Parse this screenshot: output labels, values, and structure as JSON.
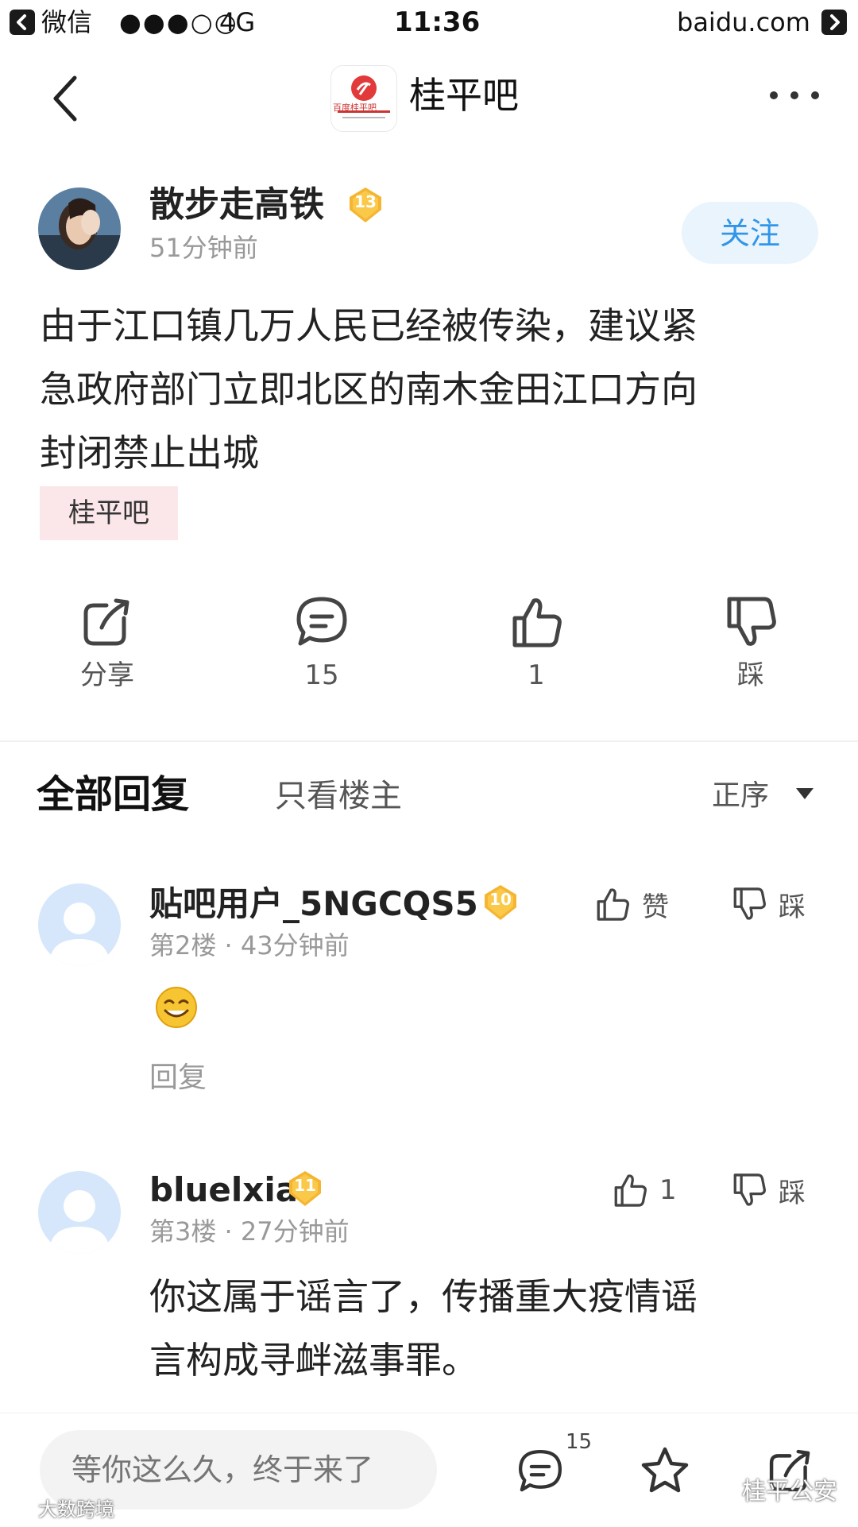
{
  "status_bar": {
    "app": "微信",
    "network": "4G",
    "time": "11:36",
    "url": "baidu.com",
    "signal_dots": "●●●○○"
  },
  "nav": {
    "title": "桂平吧",
    "logo_text": "百度桂平吧"
  },
  "post": {
    "author": "散步走高铁",
    "level": "13",
    "time": "51分钟前",
    "follow_label": "关注",
    "lines": [
      "由于江口镇几万人民已经被传染，建议紧",
      "急政府部门立即北区的南木金田江口方向",
      "封闭禁止出城"
    ],
    "tag": "桂平吧"
  },
  "actions": {
    "share": "分享",
    "comments": "15",
    "likes": "1",
    "dislike": "踩"
  },
  "tabs": {
    "all_replies": "全部回复",
    "op_only": "只看楼主",
    "sort": "正序"
  },
  "replies": [
    {
      "name": "贴吧用户_5NGCQS5",
      "level": "10",
      "meta": "第2楼 · 43分钟前",
      "like_label": "赞",
      "dislike_label": "踩",
      "body": "",
      "reply_label": "回复"
    },
    {
      "name": "bluelxia",
      "level": "11",
      "meta": "第3楼 · 27分钟前",
      "like_label": "1",
      "dislike_label": "踩",
      "body_lines": [
        "你这属于谣言了，传播重大疫情谣",
        "言构成寻衅滋事罪。"
      ]
    }
  ],
  "bottom_bar": {
    "input_placeholder": "等你这么久，终于来了",
    "comment_count": "15"
  },
  "watermarks": {
    "left": "大数跨境",
    "right": "桂平公安"
  },
  "colors": {
    "accent_blue": "#3296e8",
    "badge_gold": "#f5b530",
    "tag_pink": "#fbe7ea"
  }
}
